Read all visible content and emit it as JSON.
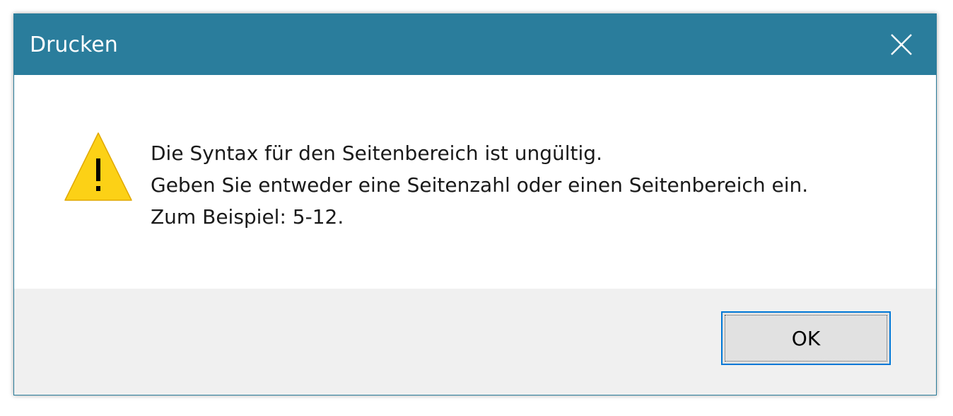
{
  "window": {
    "title": "Drucken",
    "close_icon": "close-icon",
    "titlebar_color": "#2a7d9c"
  },
  "message": {
    "icon": "warning-icon",
    "lines": [
      "Die Syntax für den Seitenbereich ist ungültig.",
      "Geben Sie entweder eine Seitenzahl oder einen Seitenbereich ein.",
      "Zum Beispiel: 5-12."
    ]
  },
  "buttons": {
    "ok_label": "OK"
  }
}
